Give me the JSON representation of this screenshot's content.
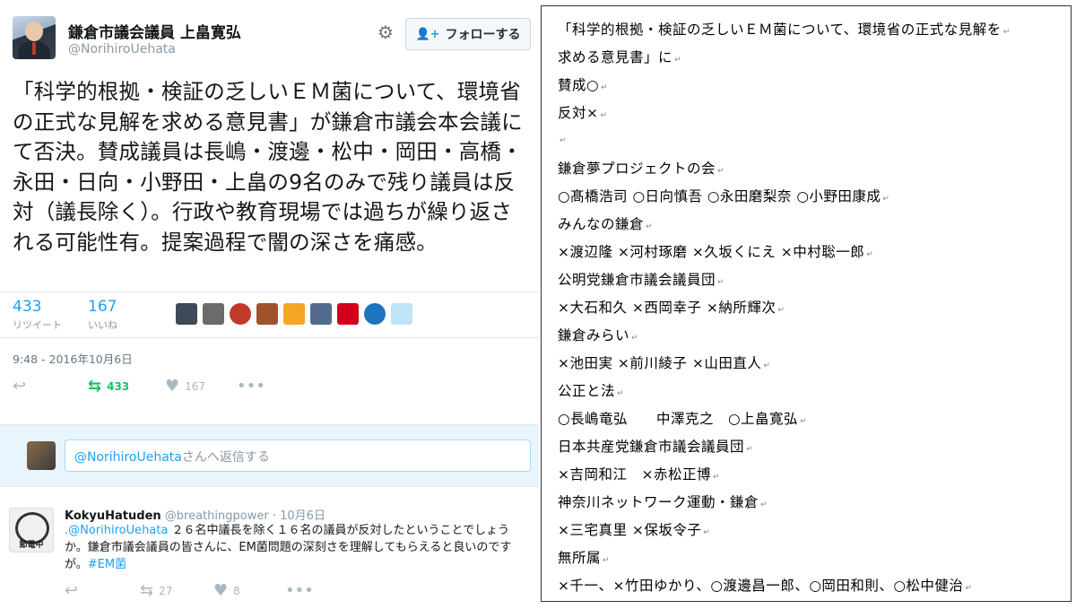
{
  "tweet": {
    "display_name": "鎌倉市議会議員 上畠寛弘",
    "handle": "@NorihiroUehata",
    "follow_label": "フォローする",
    "text": "「科学的根拠・検証の乏しいＥＭ菌について、環境省の正式な見解を求める意見書」が鎌倉市議会本会議にて否決。賛成議員は長嶋・渡邊・松中・岡田・高橋・永田・日向・小野田・上畠の9名のみで残り議員は反対（議長除く）。行政や教育現場では過ちが繰り返される可能性有。提案過程で闇の深さを痛感。",
    "retweets_count": "433",
    "retweets_label": "リツイート",
    "likes_count": "167",
    "likes_label": "いいね",
    "timestamp": "9:48 - 2016年10月6日",
    "action_retweet_count": "433",
    "action_like_count": "167",
    "accent_color": "#1da1f2",
    "retweet_color": "#17bf63"
  },
  "reply_box": {
    "mention": "@NorihiroUehata",
    "suffix": "さんへ返信する"
  },
  "reply": {
    "name": "KokyuHatuden",
    "handle": "@breathingpower",
    "date": "10月6日",
    "avatar_label": "節電中",
    "mention": ".@NorihiroUehata",
    "text": " ２６名中議長を除く１６名の議員が反対したということでしょうか。鎌倉市議会議員の皆さんに、EM菌問題の深刻さを理解してもらえると良いのですが。",
    "hashtag": "#EM菌",
    "retweet_count": "27",
    "like_count": "8"
  },
  "document": {
    "lines": [
      "「科学的根拠・検証の乏しいＥＭ菌について、環境省の正式な見解を",
      "求める意見書」に",
      "賛成○",
      "反対×",
      "",
      "鎌倉夢プロジェクトの会",
      "○髙橋浩司 ○日向慎吾 ○永田磨梨奈 ○小野田康成",
      "みんなの鎌倉",
      "×渡辺隆 ×河村琢磨 ×久坂くにえ ×中村聡一郎",
      "公明党鎌倉市議会議員団",
      "×大石和久 ×西岡幸子 ×納所輝次",
      "鎌倉みらい",
      "×池田実 ×前川綾子 ×山田直人",
      "公正と法",
      "○長嶋竜弘　　中澤克之　○上畠寛弘",
      "日本共産党鎌倉市議会議員団",
      "×吉岡和江　×赤松正博",
      "神奈川ネットワーク運動・鎌倉",
      "×三宅真里 ×保坂令子",
      "無所属",
      "×千一、×竹田ゆかり、○渡邊昌一郎、○岡田和則、○松中健治"
    ]
  }
}
